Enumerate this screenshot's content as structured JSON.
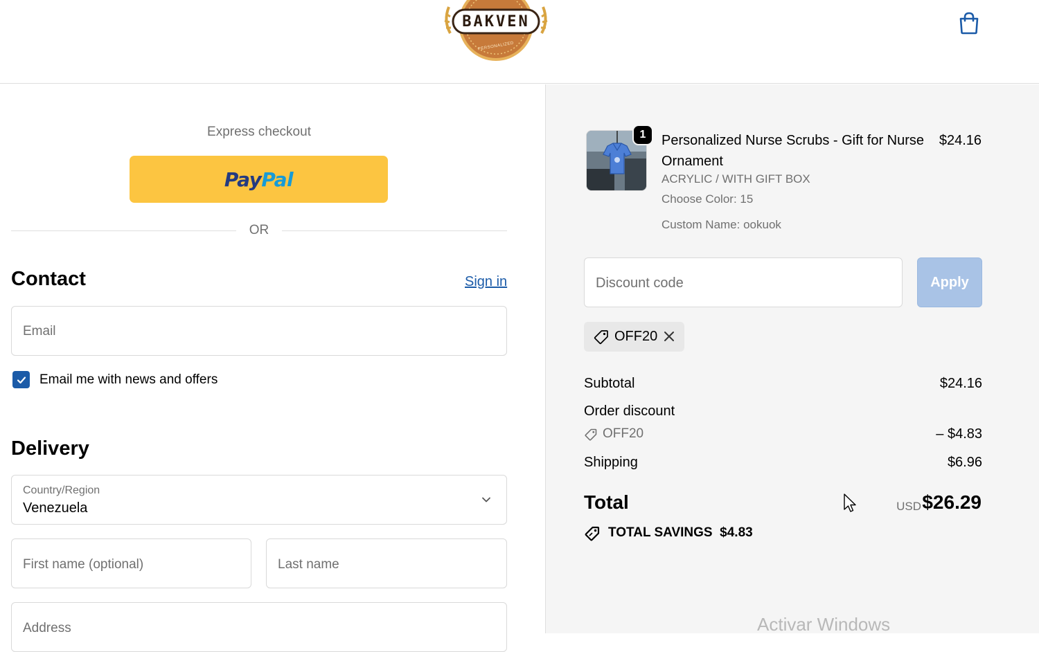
{
  "header": {
    "logo_text": "BAKVEN",
    "logo_subtext": "PERSONALIZED",
    "cart_icon": "shopping-bag-icon"
  },
  "express": {
    "label": "Express checkout",
    "paypal_pay": "Pay",
    "paypal_pal": "Pal",
    "or": "OR"
  },
  "contact": {
    "title": "Contact",
    "sign_in": "Sign in",
    "email_placeholder": "Email",
    "newsletter_label": "Email me with news and offers",
    "newsletter_checked": true
  },
  "delivery": {
    "title": "Delivery",
    "country_label": "Country/Region",
    "country_value": "Venezuela",
    "first_name_placeholder": "First name (optional)",
    "last_name_placeholder": "Last name",
    "address_placeholder": "Address"
  },
  "order": {
    "item": {
      "quantity": "1",
      "name": "Personalized Nurse Scrubs - Gift for Nurse Ornament",
      "price": "$24.16",
      "variant": "ACRYLIC / WITH GIFT BOX",
      "color": "Choose Color: 15",
      "custom_name": "Custom Name: ookuok"
    },
    "discount_placeholder": "Discount code",
    "apply_label": "Apply",
    "applied_code": "OFF20",
    "subtotal_label": "Subtotal",
    "subtotal_value": "$24.16",
    "order_discount_label": "Order discount",
    "discount_code": "OFF20",
    "discount_value": "– $4.83",
    "shipping_label": "Shipping",
    "shipping_value": "$6.96",
    "total_label": "Total",
    "total_currency": "USD",
    "total_value": "$26.29",
    "savings_label": "TOTAL SAVINGS",
    "savings_value": "$4.83"
  },
  "watermark": "Activar Windows",
  "colors": {
    "accent": "#1b5ba8",
    "paypal_yellow": "#fcc541",
    "summary_bg": "#f5f5f5"
  }
}
